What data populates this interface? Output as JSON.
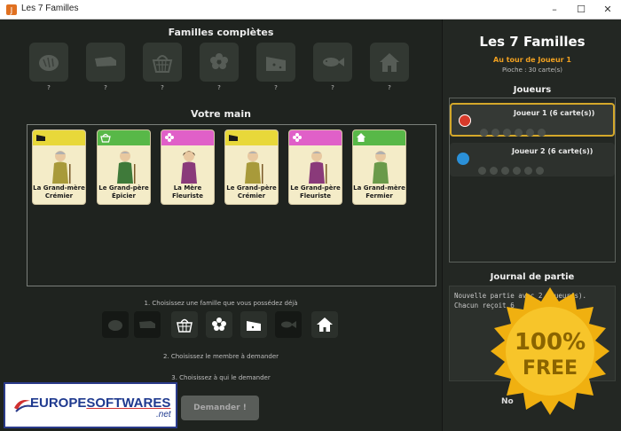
{
  "window": {
    "title": "Les 7 Familles",
    "min": "–",
    "max": "☐",
    "close": "✕"
  },
  "complete": {
    "title": "Familles complètes",
    "slots": [
      {
        "icon": "bread-icon",
        "q": "?"
      },
      {
        "icon": "truck-icon",
        "q": "?"
      },
      {
        "icon": "basket-icon",
        "q": "?"
      },
      {
        "icon": "flower-icon",
        "q": "?"
      },
      {
        "icon": "cheese-icon",
        "q": "?"
      },
      {
        "icon": "fish-icon",
        "q": "?"
      },
      {
        "icon": "house-icon",
        "q": "?"
      }
    ]
  },
  "hand": {
    "title": "Votre main",
    "cards": [
      {
        "line1": "La Grand-mère",
        "line2": "Crémier",
        "icon": "cheese-icon",
        "band": "#e8d83a"
      },
      {
        "line1": "Le Grand-père",
        "line2": "Épicier",
        "icon": "basket-icon",
        "band": "#58b848"
      },
      {
        "line1": "La Mère",
        "line2": "Fleuriste",
        "icon": "flower-icon",
        "band": "#e060c8"
      },
      {
        "line1": "Le Grand-père",
        "line2": "Crémier",
        "icon": "cheese-icon",
        "band": "#e8d83a"
      },
      {
        "line1": "Le Grand-père",
        "line2": "Fleuriste",
        "icon": "flower-icon",
        "band": "#e060c8"
      },
      {
        "line1": "La Grand-mère",
        "line2": "Fermier",
        "icon": "house-icon",
        "band": "#58b848"
      }
    ]
  },
  "steps": {
    "s1": "1. Choisissez une famille que vous possédez déjà",
    "s2": "2. Choisissez le membre à demander",
    "s3": "3. Choisissez à qui le demander"
  },
  "ask_button": "Demander !",
  "side": {
    "title": "Les 7 Familles",
    "turn": "Au tour de Joueur 1",
    "pioche": "Pioche : 30 carte(s)",
    "players_title": "Joueurs",
    "players": [
      {
        "name": "Joueur 1  (6 carte(s))",
        "color": "#d83a2a"
      },
      {
        "name": "Joueur 2  (6 carte(s))",
        "color": "#2a90d8"
      }
    ],
    "journal_title": "Journal de partie",
    "journal_lines": [
      "Nouvelle partie avec 2 joueur(s).",
      "Chacun reçoit 6"
    ],
    "bottom_text": "No"
  },
  "badge": {
    "line1": "100%",
    "line2": "FREE"
  },
  "logo": {
    "brand_a": "EUROPE",
    "brand_b": "SOFTWARES",
    "net": ".net"
  },
  "colors": {
    "accent": "#f0a020",
    "active_border": "#d4a82a",
    "bg": "#1f231f"
  }
}
